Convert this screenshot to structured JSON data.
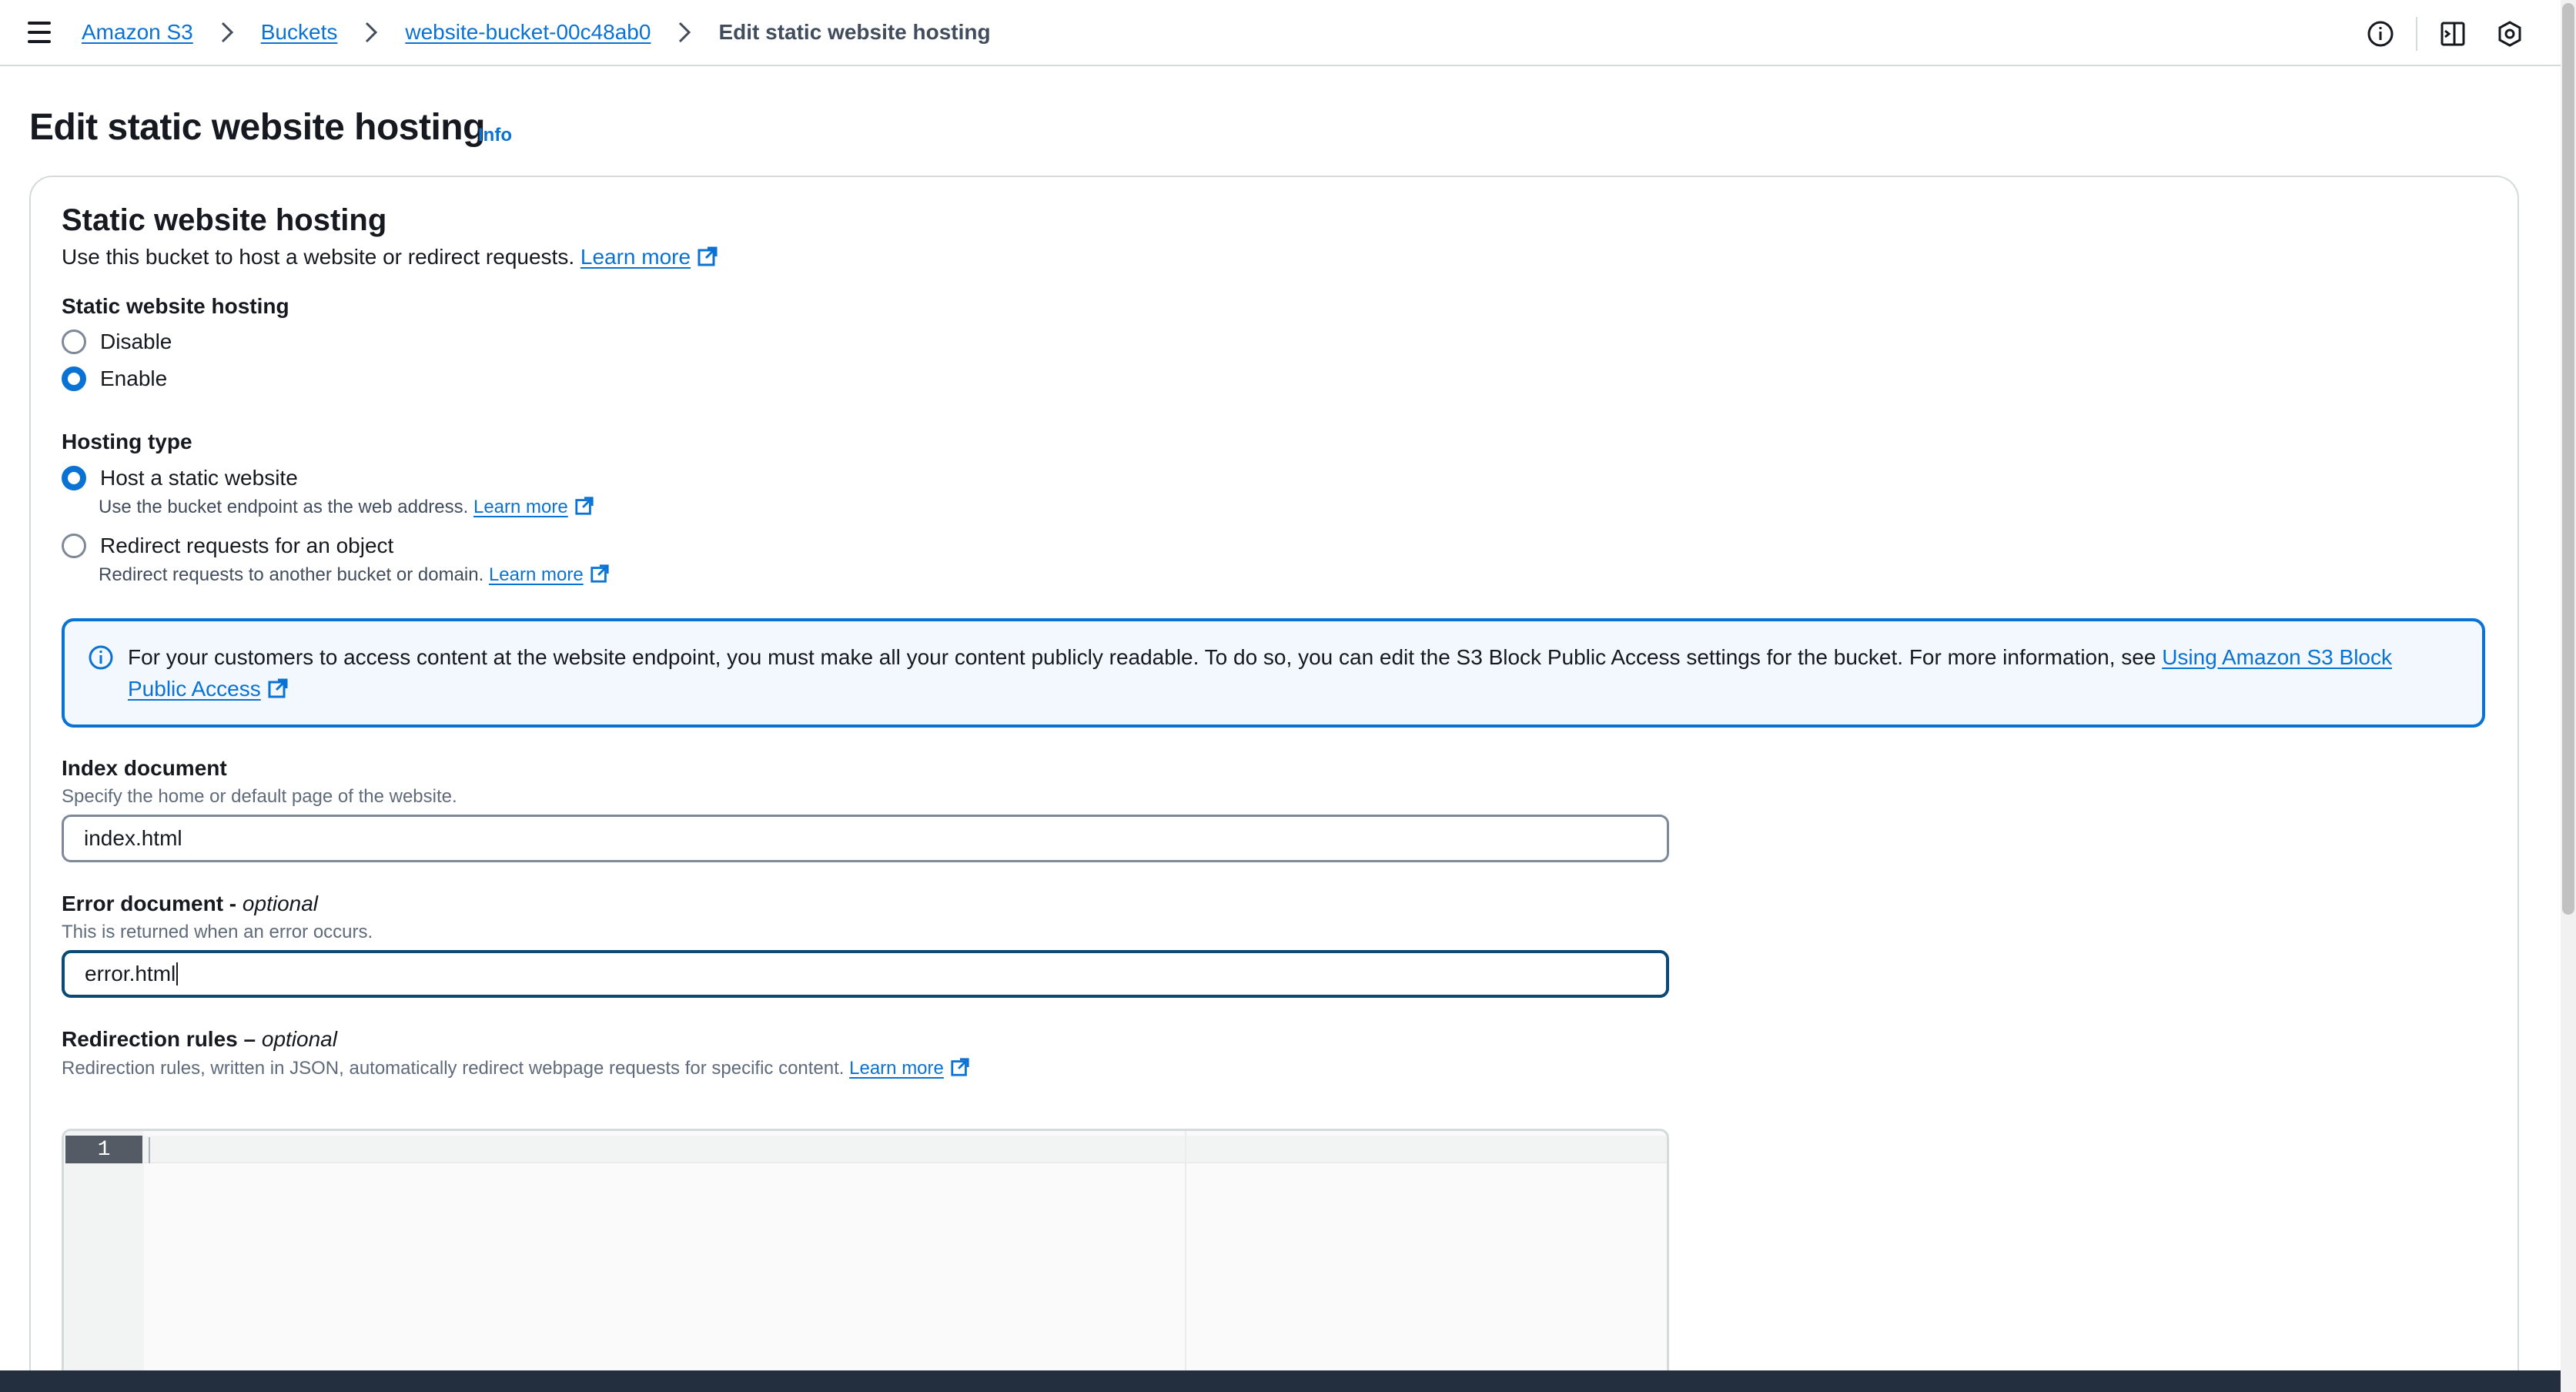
{
  "breadcrumb": {
    "items": [
      "Amazon S3",
      "Buckets",
      "website-bucket-00c48ab0"
    ],
    "current": "Edit static website hosting"
  },
  "page": {
    "title": "Edit static website hosting",
    "info": "Info"
  },
  "section": {
    "title": "Static website hosting",
    "description": "Use this bucket to host a website or redirect requests.",
    "learn_more": "Learn more"
  },
  "hosting": {
    "label": "Static website hosting",
    "options": [
      "Disable",
      "Enable"
    ],
    "selected": "Enable"
  },
  "hosting_type": {
    "label": "Hosting type",
    "options": [
      {
        "label": "Host a static website",
        "description": "Use the bucket endpoint as the web address.",
        "link": "Learn more"
      },
      {
        "label": "Redirect requests for an object",
        "description": "Redirect requests to another bucket or domain.",
        "link": "Learn more"
      }
    ],
    "selected": "Host a static website"
  },
  "alert": {
    "text": "For your customers to access content at the website endpoint, you must make all your content publicly readable. To do so, you can edit the S3 Block Public Access settings for the bucket. For more information, see",
    "link": "Using Amazon S3 Block Public Access"
  },
  "index_document": {
    "label": "Index document",
    "description": "Specify the home or default page of the website.",
    "value": "index.html"
  },
  "error_document": {
    "label": "Error document - ",
    "optional": "optional",
    "description": "This is returned when an error occurs.",
    "value": "error.html"
  },
  "redirection": {
    "label": "Redirection rules – ",
    "optional": "optional",
    "description": "Redirection rules, written in JSON, automatically redirect webpage requests for specific content.",
    "link": "Learn more",
    "line_number": "1"
  },
  "colors": {
    "link": "#0972d3",
    "radio_checked": "#0972d3",
    "alert_border": "#0972d3",
    "alert_bg": "#f2f8fd",
    "footer": "#232f3e"
  }
}
